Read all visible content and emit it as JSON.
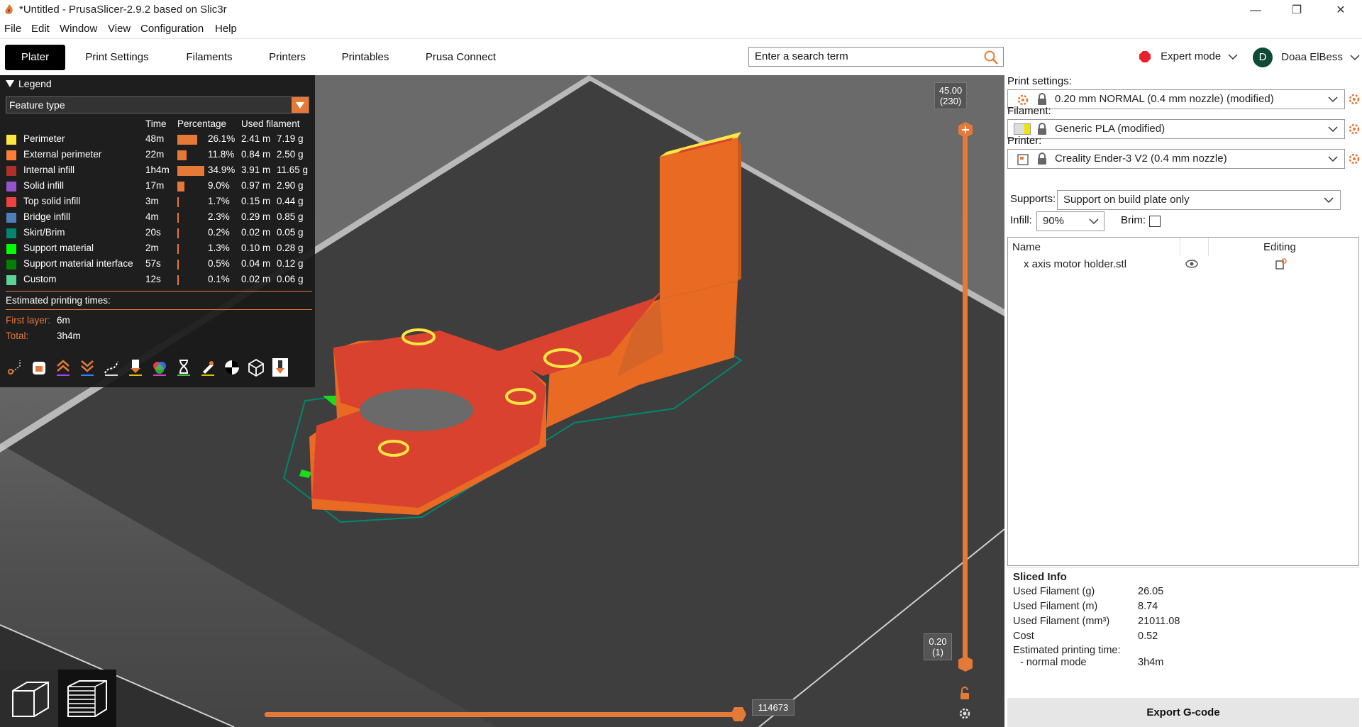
{
  "window": {
    "title": "*Untitled - PrusaSlicer-2.9.2 based on Slic3r",
    "minimize": "—",
    "maximize": "❐",
    "close": "✕"
  },
  "menu": [
    "File",
    "Edit",
    "Window",
    "View",
    "Configuration",
    "Help"
  ],
  "tabs": [
    "Plater",
    "Print Settings",
    "Filaments",
    "Printers",
    "Printables",
    "Prusa Connect"
  ],
  "search": {
    "placeholder": "Enter a search term",
    "value": "Enter a search term"
  },
  "mode": {
    "label": "Expert mode",
    "color": "#e8202a"
  },
  "user": {
    "initial": "D",
    "name": "Doaa ElBess"
  },
  "legend": {
    "header": "Legend",
    "view_type": "Feature type",
    "columns": [
      "Time",
      "Percentage",
      "Used filament"
    ],
    "rows": [
      {
        "name": "Perimeter",
        "color": "#ffe640",
        "time": "48m",
        "bar": 0.261,
        "pct": "26.1%",
        "m": "2.41 m",
        "g": "7.19 g"
      },
      {
        "name": "External perimeter",
        "color": "#ff7d38",
        "time": "22m",
        "bar": 0.118,
        "pct": "11.8%",
        "m": "0.84 m",
        "g": "2.50 g"
      },
      {
        "name": "Internal infill",
        "color": "#b03029",
        "time": "1h4m",
        "bar": 0.349,
        "pct": "34.9%",
        "m": "3.91 m",
        "g": "11.65 g"
      },
      {
        "name": "Solid infill",
        "color": "#9654cc",
        "time": "17m",
        "bar": 0.09,
        "pct": "9.0%",
        "m": "0.97 m",
        "g": "2.90 g"
      },
      {
        "name": "Top solid infill",
        "color": "#f04040",
        "time": "3m",
        "bar": 0.017,
        "pct": "1.7%",
        "m": "0.15 m",
        "g": "0.44 g"
      },
      {
        "name": "Bridge infill",
        "color": "#4d80ba",
        "time": "4m",
        "bar": 0.023,
        "pct": "2.3%",
        "m": "0.29 m",
        "g": "0.85 g"
      },
      {
        "name": "Skirt/Brim",
        "color": "#00876e",
        "time": "20s",
        "bar": 0.002,
        "pct": "0.2%",
        "m": "0.02 m",
        "g": "0.05 g"
      },
      {
        "name": "Support material",
        "color": "#00ff00",
        "time": "2m",
        "bar": 0.013,
        "pct": "1.3%",
        "m": "0.10 m",
        "g": "0.28 g"
      },
      {
        "name": "Support material interface",
        "color": "#008000",
        "time": "57s",
        "bar": 0.005,
        "pct": "0.5%",
        "m": "0.04 m",
        "g": "0.12 g"
      },
      {
        "name": "Custom",
        "color": "#5ed194",
        "time": "12s",
        "bar": 0.001,
        "pct": "0.1%",
        "m": "0.02 m",
        "g": "0.06 g"
      }
    ],
    "estimated_label": "Estimated printing times:",
    "first_layer_label": "First layer:",
    "first_layer_value": "6m",
    "total_label": "Total:",
    "total_value": "3h4m"
  },
  "vslider": {
    "top_value": "45.00",
    "top_layer": "(230)",
    "bottom_value": "0.20",
    "bottom_layer": "(1)"
  },
  "hslider": {
    "value": "114673"
  },
  "right_panel": {
    "print_settings_label": "Print settings:",
    "print_settings_value": "0.20 mm NORMAL (0.4 mm nozzle) (modified)",
    "filament_label": "Filament:",
    "filament_value": "Generic PLA (modified)",
    "filament_color": "#f2e400",
    "printer_label": "Printer:",
    "printer_value": "Creality Ender-3 V2 (0.4 mm nozzle)",
    "supports_label": "Supports:",
    "supports_value": "Support on build plate only",
    "infill_label": "Infill:",
    "infill_value": "90%",
    "brim_label": "Brim:",
    "list_name_header": "Name",
    "list_editing_header": "Editing",
    "object_name": "x axis motor holder.stl"
  },
  "sliced_info": {
    "title": "Sliced Info",
    "rows": [
      {
        "label": "Used Filament (g)",
        "value": "26.05"
      },
      {
        "label": "Used Filament (m)",
        "value": "8.74"
      },
      {
        "label": "Used Filament (mm³)",
        "value": "21011.08"
      },
      {
        "label": "Cost",
        "value": "0.52"
      }
    ],
    "estimated_label": "Estimated printing time:",
    "mode_label": "- normal mode",
    "mode_value": "3h4m"
  },
  "export_button": "Export G-code"
}
